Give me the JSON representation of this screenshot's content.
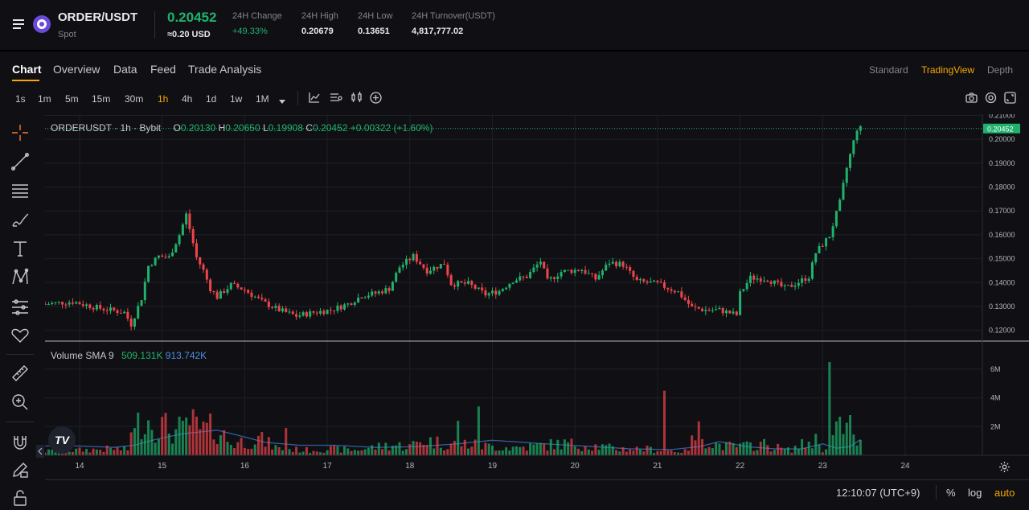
{
  "header": {
    "pair": "ORDER/USDT",
    "market": "Spot",
    "price": "0.20452",
    "price_usd": "≈0.20 USD",
    "stats": [
      {
        "label": "24H Change",
        "value": "+49.33%",
        "color": "#20b26c"
      },
      {
        "label": "24H High",
        "value": "0.20679",
        "color": "#e6e8ea"
      },
      {
        "label": "24H Low",
        "value": "0.13651",
        "color": "#e6e8ea"
      },
      {
        "label": "24H Turnover(USDT)",
        "value": "4,817,777.02",
        "color": "#e6e8ea"
      }
    ]
  },
  "tabs": [
    "Chart",
    "Overview",
    "Data",
    "Feed",
    "Trade Analysis"
  ],
  "active_tab": "Chart",
  "view_modes": [
    "Standard",
    "TradingView",
    "Depth"
  ],
  "active_view": "TradingView",
  "intervals": [
    "1s",
    "1m",
    "5m",
    "15m",
    "30m",
    "1h",
    "4h",
    "1d",
    "1w",
    "1M"
  ],
  "active_interval": "1h",
  "toolbar_icons": [
    "chart-type-icon",
    "indicators-icon",
    "candles-icon",
    "add-icon"
  ],
  "right_icons": [
    "camera-icon",
    "settings-icon",
    "fullscreen-icon"
  ],
  "left_tools": [
    "crosshair-icon",
    "trend-line-icon",
    "horizontal-lines-icon",
    "brush-icon",
    "text-icon",
    "pattern-icon",
    "prediction-icon",
    "heart-icon",
    "ruler-icon",
    "zoom-in-icon",
    "magnet-icon",
    "lock-drawing-icon",
    "lock-icon"
  ],
  "legend": {
    "symbol": "ORDERUSDT · 1h · Bybit",
    "o_label": "O",
    "o": "0.20130",
    "h_label": "H",
    "h": "0.20650",
    "l_label": "L",
    "l": "0.19908",
    "c_label": "C",
    "c": "0.20452",
    "change": "+0.00322 (+1.60%)"
  },
  "volume_legend": {
    "label": "Volume SMA 9",
    "v1": "509.131K",
    "v2": "913.742K"
  },
  "footer": {
    "time": "12:10:07 (UTC+9)",
    "percent": "%",
    "log": "log",
    "auto": "auto"
  },
  "logo": "TV",
  "colors": {
    "up": "#20b26c",
    "down": "#ef454a",
    "accent": "#f7a600",
    "sma": "#2962ff"
  },
  "chart_data": {
    "type": "candlestick",
    "price_axis": {
      "ticks": [
        "0.21000",
        "0.20000",
        "0.19000",
        "0.18000",
        "0.17000",
        "0.16000",
        "0.15000",
        "0.14000",
        "0.13000",
        "0.12000"
      ],
      "range": [
        0.1155,
        0.2105
      ],
      "last_price_label": "0.20452"
    },
    "volume_axis": {
      "ticks": [
        "6M",
        "4M",
        "2M"
      ],
      "max": 6500000
    },
    "x_ticks": [
      "14",
      "15",
      "16",
      "17",
      "18",
      "19",
      "20",
      "21",
      "22",
      "23",
      "24"
    ],
    "x_tick_hours": [
      0,
      24,
      48,
      72,
      96,
      120,
      144,
      168,
      192,
      216,
      240
    ],
    "start_hour": -10,
    "end_hour": 250,
    "close_path": [
      [
        -10,
        0.131
      ],
      [
        -2,
        0.132
      ],
      [
        5,
        0.1295
      ],
      [
        13,
        0.1275
      ],
      [
        15,
        0.1225
      ],
      [
        18,
        0.1335
      ],
      [
        20,
        0.147
      ],
      [
        23,
        0.151
      ],
      [
        26,
        0.1505
      ],
      [
        29,
        0.16
      ],
      [
        31,
        0.1685
      ],
      [
        34,
        0.1505
      ],
      [
        36,
        0.145
      ],
      [
        38,
        0.1375
      ],
      [
        40,
        0.134
      ],
      [
        44,
        0.139
      ],
      [
        48,
        0.137
      ],
      [
        53,
        0.132
      ],
      [
        58,
        0.1285
      ],
      [
        63,
        0.126
      ],
      [
        68,
        0.1275
      ],
      [
        73,
        0.1285
      ],
      [
        78,
        0.131
      ],
      [
        82,
        0.1345
      ],
      [
        86,
        0.1355
      ],
      [
        90,
        0.1375
      ],
      [
        93,
        0.1465
      ],
      [
        97,
        0.151
      ],
      [
        101,
        0.145
      ],
      [
        106,
        0.148
      ],
      [
        108,
        0.1395
      ],
      [
        113,
        0.1395
      ],
      [
        118,
        0.135
      ],
      [
        122,
        0.1365
      ],
      [
        126,
        0.141
      ],
      [
        130,
        0.1425
      ],
      [
        134,
        0.149
      ],
      [
        136,
        0.1405
      ],
      [
        140,
        0.1445
      ],
      [
        146,
        0.1455
      ],
      [
        150,
        0.1415
      ],
      [
        154,
        0.1485
      ],
      [
        158,
        0.1475
      ],
      [
        162,
        0.1405
      ],
      [
        168,
        0.1395
      ],
      [
        174,
        0.136
      ],
      [
        178,
        0.1295
      ],
      [
        182,
        0.1285
      ],
      [
        186,
        0.1285
      ],
      [
        191,
        0.1265
      ],
      [
        192,
        0.1355
      ],
      [
        195,
        0.142
      ],
      [
        200,
        0.1415
      ],
      [
        205,
        0.1375
      ],
      [
        208,
        0.1395
      ],
      [
        212,
        0.1425
      ],
      [
        214,
        0.1525
      ],
      [
        218,
        0.1595
      ],
      [
        221,
        0.1735
      ],
      [
        223,
        0.188
      ],
      [
        226,
        0.2045
      ],
      [
        227,
        0.2045
      ]
    ],
    "volume_path": [
      [
        -10,
        300000
      ],
      [
        10,
        500000
      ],
      [
        14,
        400000
      ],
      [
        18,
        3000000
      ],
      [
        22,
        2500000
      ],
      [
        28,
        1800000
      ],
      [
        32,
        2600000
      ],
      [
        35,
        1900000
      ],
      [
        40,
        2100000
      ],
      [
        44,
        900000
      ],
      [
        52,
        1300000
      ],
      [
        58,
        500000
      ],
      [
        66,
        400000
      ],
      [
        72,
        500000
      ],
      [
        80,
        400000
      ],
      [
        90,
        800000
      ],
      [
        96,
        700000
      ],
      [
        100,
        1200000
      ],
      [
        106,
        900000
      ],
      [
        112,
        900000
      ],
      [
        118,
        700000
      ],
      [
        126,
        600000
      ],
      [
        132,
        700000
      ],
      [
        140,
        900000
      ],
      [
        148,
        800000
      ],
      [
        156,
        500000
      ],
      [
        164,
        500000
      ],
      [
        176,
        300000
      ],
      [
        180,
        1800000
      ],
      [
        184,
        900000
      ],
      [
        188,
        700000
      ],
      [
        194,
        700000
      ],
      [
        198,
        900000
      ],
      [
        206,
        400000
      ],
      [
        214,
        1200000
      ],
      [
        216,
        500000
      ],
      [
        222,
        2400000
      ],
      [
        225,
        1200000
      ],
      [
        227,
        900000
      ]
    ],
    "volume_spikes": [
      [
        15,
        1600000
      ],
      [
        30,
        2400000
      ],
      [
        60,
        1900000
      ],
      [
        110,
        2400000
      ],
      [
        116,
        3400000
      ],
      [
        170,
        4500000
      ],
      [
        218,
        6500000
      ],
      [
        224,
        2800000
      ]
    ],
    "sma_path": [
      [
        -10,
        650000
      ],
      [
        0,
        650000
      ],
      [
        10,
        550000
      ],
      [
        16,
        700000
      ],
      [
        22,
        1100000
      ],
      [
        30,
        1500000
      ],
      [
        40,
        1750000
      ],
      [
        46,
        1400000
      ],
      [
        54,
        900000
      ],
      [
        64,
        700000
      ],
      [
        74,
        700000
      ],
      [
        86,
        550000
      ],
      [
        98,
        600000
      ],
      [
        110,
        800000
      ],
      [
        120,
        1050000
      ],
      [
        132,
        850000
      ],
      [
        146,
        650000
      ],
      [
        160,
        450000
      ],
      [
        172,
        400000
      ],
      [
        180,
        600000
      ],
      [
        186,
        950000
      ],
      [
        194,
        600000
      ],
      [
        202,
        450000
      ],
      [
        210,
        450000
      ],
      [
        216,
        800000
      ],
      [
        220,
        500000
      ],
      [
        224,
        600000
      ],
      [
        227,
        1100000
      ]
    ]
  }
}
